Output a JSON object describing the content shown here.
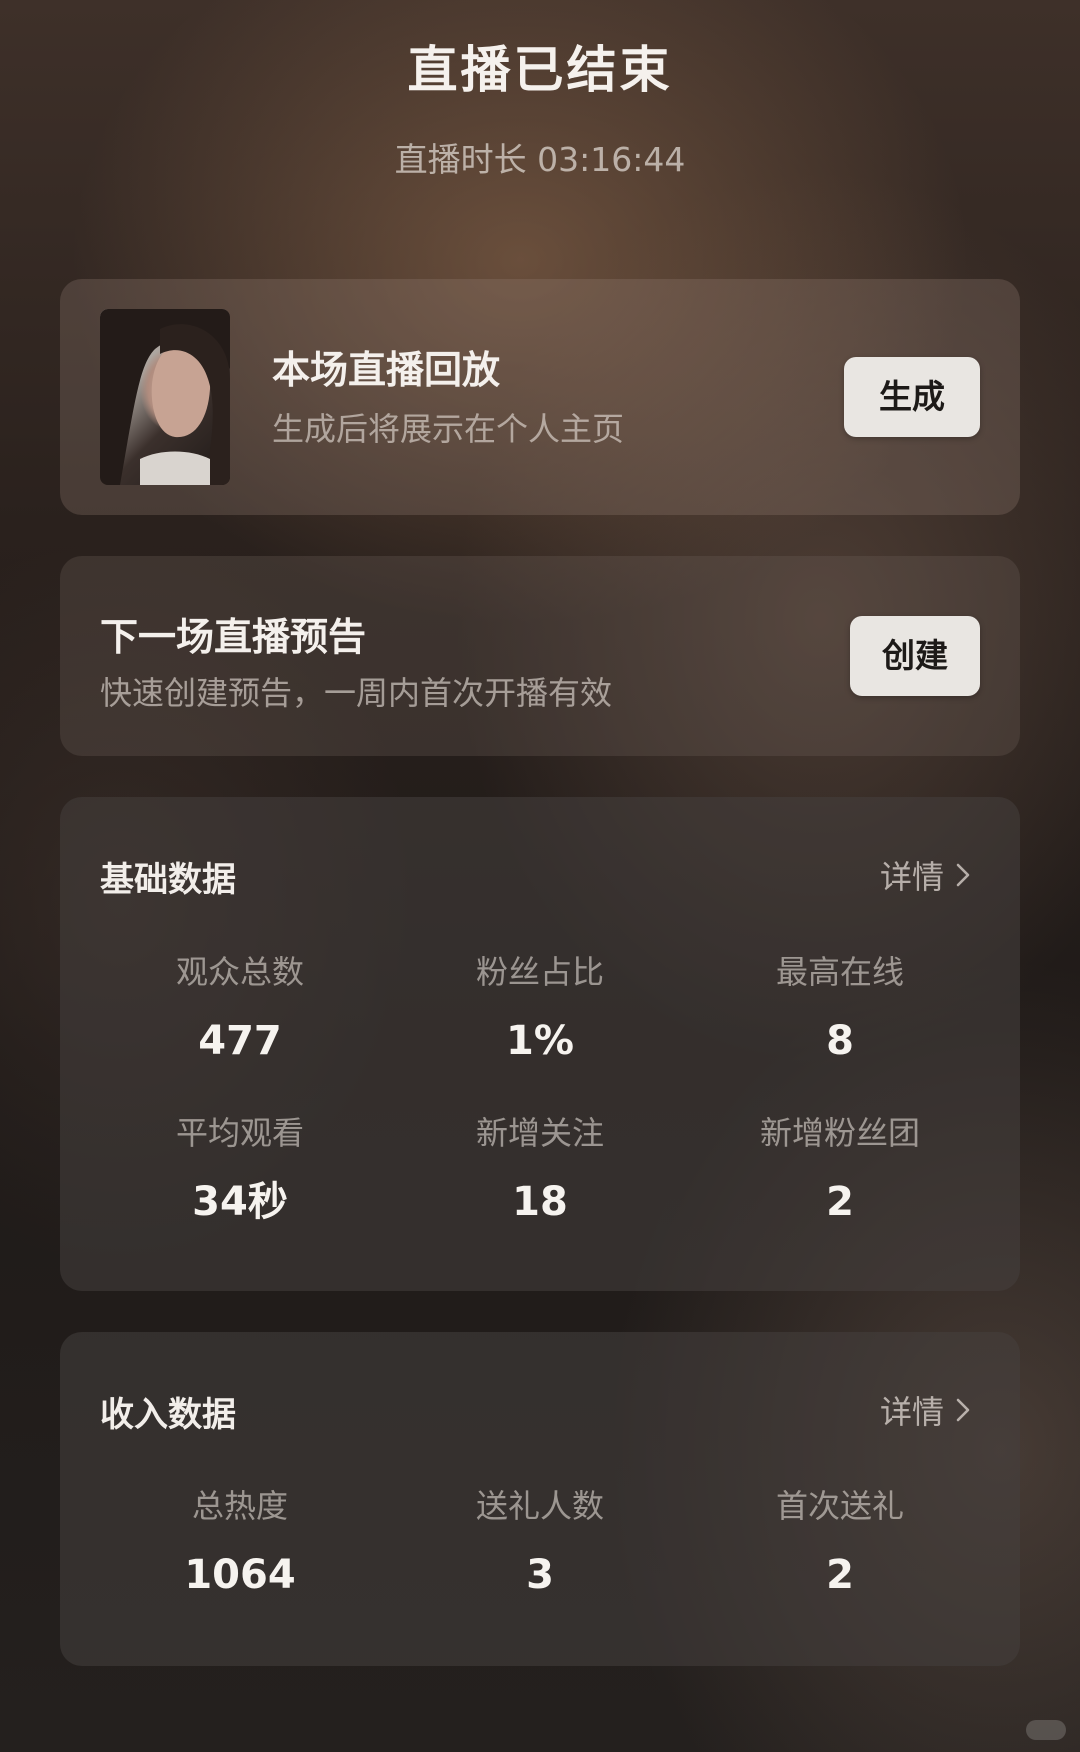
{
  "header": {
    "title": "直播已结束",
    "duration": "直播时长 03:16:44"
  },
  "replay": {
    "title": "本场直播回放",
    "subtitle": "生成后将展示在个人主页",
    "button": "生成"
  },
  "preview": {
    "title": "下一场直播预告",
    "subtitle": "快速创建预告，一周内首次开播有效",
    "button": "创建"
  },
  "basic": {
    "title": "基础数据",
    "details": "详情",
    "stats": [
      {
        "label": "观众总数",
        "value": "477"
      },
      {
        "label": "粉丝占比",
        "value": "1%"
      },
      {
        "label": "最高在线",
        "value": "8"
      },
      {
        "label": "平均观看",
        "value": "34秒"
      },
      {
        "label": "新增关注",
        "value": "18"
      },
      {
        "label": "新增粉丝团",
        "value": "2"
      }
    ]
  },
  "income": {
    "title": "收入数据",
    "details": "详情",
    "stats": [
      {
        "label": "总热度",
        "value": "1064"
      },
      {
        "label": "送礼人数",
        "value": "3"
      },
      {
        "label": "首次送礼",
        "value": "2"
      }
    ]
  },
  "icons": {
    "details_chevron": "chevron-right-icon"
  }
}
